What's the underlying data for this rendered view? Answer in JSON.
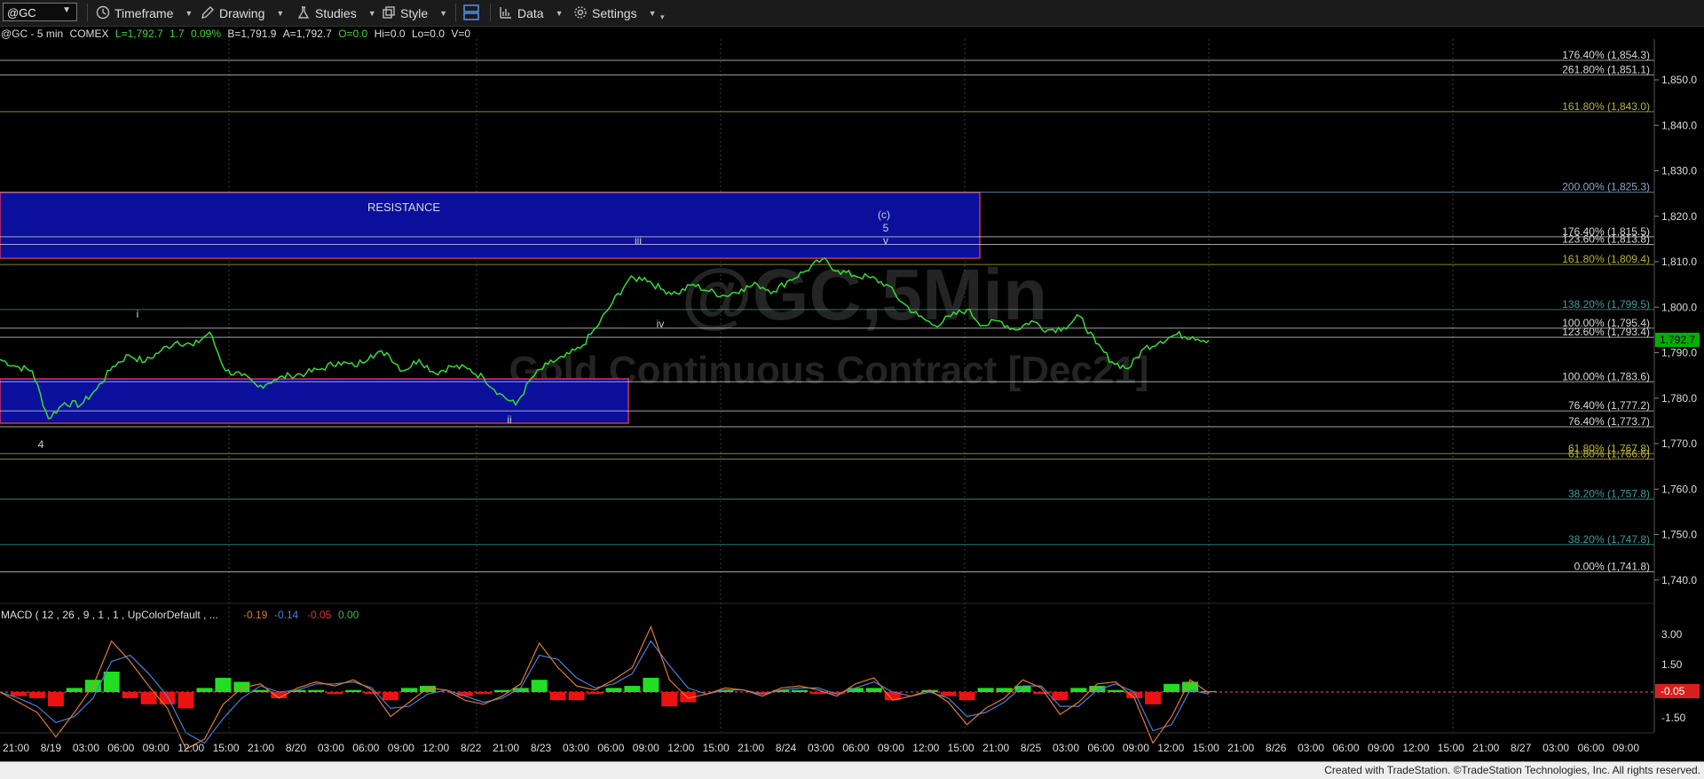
{
  "toolbar": {
    "symbol": "@GC",
    "timeframe_label": "Timeframe",
    "drawing_label": "Drawing",
    "studies_label": "Studies",
    "style_label": "Style",
    "data_label": "Data",
    "settings_label": "Settings"
  },
  "info": {
    "symbol_desc": "@GC - 5 min",
    "exchange": "COMEX",
    "last": "L=1,792.7",
    "change": "1.7",
    "change_pct": "0.09%",
    "bid": "B=1,791.9",
    "ask": "A=1,792.7",
    "open": "O=0.0",
    "high": "Hi=0.0",
    "low": "Lo=0.0",
    "volume": "V=0"
  },
  "watermark": {
    "symbol": "@GC,5Min",
    "contract": "Gold Continuous Contract [Dec21]"
  },
  "price_axis": {
    "ticks": [
      "1,850.0",
      "1,840.0",
      "1,830.0",
      "1,820.0",
      "1,810.0",
      "1,800.0",
      "1,790.0",
      "1,780.0",
      "1,770.0",
      "1,760.0",
      "1,750.0",
      "1,740.0"
    ],
    "last_price_label": "1,792.7",
    "last_price_color": "#00c000"
  },
  "time_axis": {
    "labels": [
      "21:00",
      "8/19",
      "03:00",
      "06:00",
      "09:00",
      "12:00",
      "15:00",
      "21:00",
      "8/20",
      "03:00",
      "06:00",
      "09:00",
      "12:00",
      "8/22",
      "21:00",
      "8/23",
      "03:00",
      "06:00",
      "09:00",
      "12:00",
      "15:00",
      "21:00",
      "8/24",
      "03:00",
      "06:00",
      "09:00",
      "12:00",
      "15:00",
      "21:00",
      "8/25",
      "03:00",
      "06:00",
      "09:00",
      "12:00",
      "15:00",
      "21:00",
      "8/26",
      "03:00",
      "06:00",
      "09:00",
      "12:00",
      "15:00",
      "21:00",
      "8/27",
      "03:00",
      "06:00",
      "09:00"
    ]
  },
  "zones": [
    {
      "label": "RESISTANCE",
      "color": "#0a0f9c"
    },
    {
      "label": "",
      "color": "#0a0f9c"
    }
  ],
  "fib_levels": [
    {
      "text": "176.40% (1,854.3)",
      "value": 1854.3,
      "color": "#d8d8d8"
    },
    {
      "text": "261.80% (1,851.1)",
      "value": 1851.1,
      "color": "#d8d8d8"
    },
    {
      "text": "161.80% (1,843.0)",
      "value": 1843.0,
      "color": "#b8b23a"
    },
    {
      "text": "200.00% (1,825.3)",
      "value": 1825.3,
      "color": "#7fa8c9"
    },
    {
      "text": "176.40% (1,815.5)",
      "value": 1815.5,
      "color": "#d8d8d8"
    },
    {
      "text": "123.60% (1,813.8)",
      "value": 1813.8,
      "color": "#d8d8d8"
    },
    {
      "text": "161.80% (1,809.4)",
      "value": 1809.4,
      "color": "#b8b23a"
    },
    {
      "text": "138.20% (1,799.5)",
      "value": 1799.5,
      "color": "#3d9b9b"
    },
    {
      "text": "100.00% (1,795.4)",
      "value": 1795.4,
      "color": "#d8d8d8"
    },
    {
      "text": "123.60% (1,793.4)",
      "value": 1793.4,
      "color": "#d8d8d8"
    },
    {
      "text": "100.00% (1,783.6)",
      "value": 1783.6,
      "color": "#d8d8d8"
    },
    {
      "text": "76.40% (1,777.2)",
      "value": 1777.2,
      "color": "#d8d8d8"
    },
    {
      "text": "76.40% (1,773.7)",
      "value": 1773.7,
      "color": "#d8d8d8"
    },
    {
      "text": "61.80% (1,767.8)",
      "value": 1767.8,
      "color": "#b8b23a"
    },
    {
      "text": "61.80% (1,766.6)",
      "value": 1766.6,
      "color": "#b8b23a"
    },
    {
      "text": "38.20% (1,757.8)",
      "value": 1757.8,
      "color": "#3d9b9b"
    },
    {
      "text": "38.20% (1,747.8)",
      "value": 1747.8,
      "color": "#3d9b9b"
    },
    {
      "text": "0.00% (1,741.8)",
      "value": 1741.8,
      "color": "#d8d8d8"
    }
  ],
  "wave_labels": [
    "4",
    "i",
    "ii",
    "iii",
    "iv",
    "(c)",
    "5",
    "v"
  ],
  "price_series": [
    1788.5,
    1787,
    1786,
    1775.5,
    1779,
    1778.5,
    1782,
    1787,
    1789.5,
    1788,
    1790.5,
    1792.5,
    1791.5,
    1794.5,
    1786,
    1785,
    1782.5,
    1784,
    1785,
    1785.5,
    1786.5,
    1788,
    1787,
    1789.5,
    1790,
    1786,
    1788.5,
    1785.5,
    1787,
    1786.5,
    1784.5,
    1781,
    1778.5,
    1784.5,
    1787.5,
    1789,
    1791,
    1795.5,
    1801,
    1806,
    1806.5,
    1804,
    1803,
    1805,
    1803.5,
    1802.5,
    1804,
    1805,
    1803.5,
    1806,
    1808,
    1810.5,
    1808,
    1807,
    1806.5,
    1805,
    1801,
    1798,
    1796,
    1798,
    1799.5,
    1796,
    1797,
    1795,
    1797,
    1795,
    1795.5,
    1798,
    1792,
    1788,
    1786.5,
    1791,
    1792.5,
    1794,
    1793.5,
    1792.7
  ],
  "macd": {
    "title": "MACD ( 12 , 26 , 9 , 1 , 1 , UpColorDefault , ...",
    "values": [
      "-0.19",
      "-0.14",
      "-0.05",
      "0.00"
    ],
    "value_colors": [
      "#e0792b",
      "#4a7fd6",
      "#e03030",
      "#3cb83c"
    ],
    "ticks": [
      "3.00",
      "1.50",
      "-1.50"
    ],
    "current_label": "-0.05",
    "macd_line": [
      0,
      -0.5,
      -1,
      -2.2,
      -1,
      0.3,
      2.5,
      1.5,
      0.3,
      -0.8,
      -2.8,
      -2.3,
      -0.6,
      0.2,
      0.4,
      -0.3,
      0.2,
      0.5,
      0.3,
      0.6,
      0.1,
      -1.2,
      -0.5,
      0.2,
      0.1,
      -0.4,
      -0.6,
      -0.2,
      0.4,
      2.4,
      1.2,
      0.3,
      0.1,
      0.6,
      1.2,
      3.2,
      0.6,
      -0.3,
      -0.1,
      0.2,
      0.1,
      -0.2,
      0.2,
      0.3,
      0.1,
      -0.2,
      0.4,
      0.7,
      -0.4,
      -0.2,
      0.1,
      -0.5,
      -1.6,
      -0.8,
      -0.3,
      0.6,
      0.2,
      -1.1,
      -0.5,
      0.4,
      0.5,
      -0.3,
      -2.5,
      -1.2,
      0.6,
      -0.05
    ],
    "signal_line": [
      0,
      -0.3,
      -0.7,
      -1.5,
      -1.2,
      -0.3,
      1.5,
      1.8,
      0.9,
      -0.2,
      -2,
      -2.5,
      -1.3,
      -0.3,
      0.3,
      0,
      0.1,
      0.4,
      0.4,
      0.5,
      0.2,
      -0.8,
      -0.7,
      -0.1,
      0.1,
      -0.2,
      -0.5,
      -0.3,
      0.2,
      1.8,
      1.6,
      0.7,
      0.2,
      0.4,
      0.9,
      2.5,
      1.3,
      0.2,
      -0.1,
      0.1,
      0.1,
      -0.1,
      0.1,
      0.2,
      0.2,
      -0.1,
      0.2,
      0.5,
      0,
      -0.2,
      0,
      -0.3,
      -1.2,
      -1,
      -0.5,
      0.3,
      0.3,
      -0.7,
      -0.7,
      0.1,
      0.4,
      0,
      -1.9,
      -1.6,
      0.1,
      -0.1
    ]
  },
  "footer": {
    "text": "Created with TradeStation. ©TradeStation Technologies, Inc. All rights reserved."
  },
  "colors": {
    "price_line": "#33dd33",
    "zone_fill": "#0a0f9c",
    "zone_border": "#d0305a",
    "macd_line": "#e0792b",
    "signal_line": "#4a7fd6",
    "hist_up": "#22dd22",
    "hist_down": "#ee1111"
  }
}
